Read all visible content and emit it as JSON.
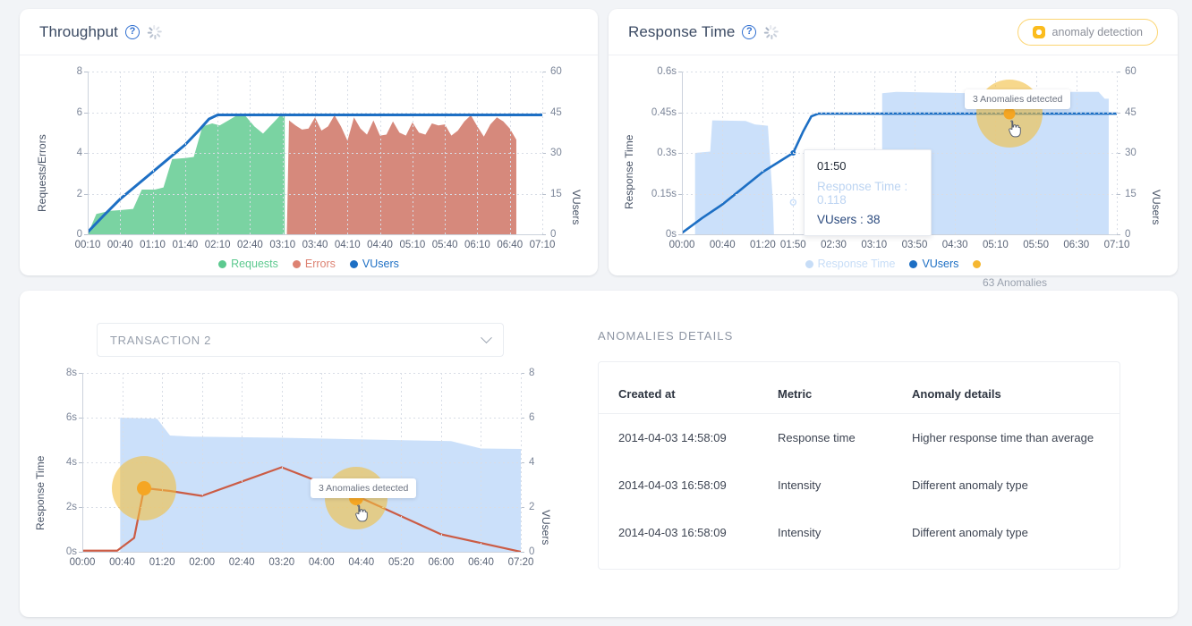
{
  "throughput": {
    "title": "Throughput",
    "help_icon": "question-circle-icon",
    "spinner_icon": "loading-spinner-icon",
    "legend": [
      {
        "label": "Requests",
        "color": "#5cc98f"
      },
      {
        "label": "Errors",
        "color": "#dd8272"
      },
      {
        "label": "VUsers",
        "color": "#1d6fc4"
      }
    ]
  },
  "response_time": {
    "title": "Response Time",
    "help_icon": "question-circle-icon",
    "spinner_icon": "loading-spinner-icon",
    "anomaly_button": {
      "label": "anomaly detection",
      "icon": "gear-icon",
      "color": "#fbbc1e"
    },
    "tooltip": {
      "time": "01:50",
      "response_time": "Response Time : 0.118",
      "vusers": "VUsers : 38"
    },
    "anomaly_marker_label": "3 Anomalies detected",
    "anomaly_count": "63 Anomalies",
    "legend": [
      {
        "label": "Response Time",
        "color": "#c7ddf7"
      },
      {
        "label": "VUsers",
        "color": "#1d6fc4"
      },
      {
        "label": "",
        "color": "#f5b731"
      }
    ]
  },
  "bottom": {
    "transaction_select": {
      "value": "TRANSACTION 2",
      "icon": "chevron-down-icon"
    },
    "anomaly_marker_label": "3 Anomalies detected",
    "section_title": "ANOMALIES DETAILS",
    "table": {
      "headers": [
        "Created at",
        "Metric",
        "Anomaly details"
      ],
      "rows": [
        [
          "2014-04-03 14:58:09",
          "Response time",
          "Higher response time than average"
        ],
        [
          "2014-04-03 16:58:09",
          "Intensity",
          "Different anomaly type"
        ],
        [
          "2014-04-03 16:58:09",
          "Intensity",
          "Different anomaly type"
        ]
      ]
    }
  },
  "chart_data": [
    {
      "type": "area",
      "id": "throughput",
      "title": "Throughput",
      "xlabel": "",
      "ylabel": "Requests/Errors",
      "y2label": "VUsers",
      "ylim": [
        0,
        8
      ],
      "y2lim": [
        0,
        60
      ],
      "yticks": [
        0,
        2,
        4,
        6,
        8
      ],
      "y2ticks": [
        0,
        15,
        30,
        45,
        60
      ],
      "xticks": [
        "00:10",
        "00:40",
        "01:10",
        "01:40",
        "02:10",
        "02:40",
        "03:10",
        "03:40",
        "04:10",
        "04:40",
        "05:10",
        "05:40",
        "06:10",
        "06:40",
        "07:10"
      ],
      "grid": true,
      "legend_position": "bottom",
      "series": [
        {
          "name": "Requests",
          "type": "area",
          "color": "#5cc98f",
          "axis": "left",
          "x": [
            "00:10",
            "00:25",
            "00:40",
            "00:55",
            "01:10",
            "01:25",
            "01:40",
            "01:55",
            "02:10",
            "02:25",
            "02:40",
            "02:55",
            "03:10"
          ],
          "values": [
            0.0,
            1.1,
            1.2,
            1.3,
            2.2,
            2.25,
            3.7,
            3.8,
            5.3,
            5.8,
            5.5,
            5.0,
            5.9
          ]
        },
        {
          "name": "Errors",
          "type": "area",
          "color": "#dd8272",
          "axis": "left",
          "x": [
            "03:15",
            "03:30",
            "03:45",
            "04:00",
            "04:15",
            "04:30",
            "04:45",
            "05:00",
            "05:15",
            "05:30",
            "05:45",
            "06:00",
            "06:15",
            "06:30",
            "06:45"
          ],
          "values": [
            5.6,
            5.2,
            5.3,
            5.8,
            4.6,
            5.7,
            4.8,
            5.6,
            4.9,
            5.4,
            5.4,
            4.8,
            5.8,
            5.7,
            4.7
          ]
        },
        {
          "name": "VUsers",
          "type": "line",
          "color": "#1d6fc4",
          "axis": "right",
          "x": [
            "00:10",
            "00:40",
            "01:10",
            "01:40",
            "02:10",
            "03:10",
            "04:10",
            "05:10",
            "06:10",
            "07:10"
          ],
          "values": [
            1,
            13,
            23,
            33,
            44,
            44,
            44,
            44,
            44,
            44
          ]
        }
      ]
    },
    {
      "type": "area",
      "id": "response_time",
      "title": "Response Time",
      "xlabel": "",
      "ylabel": "Response Time",
      "y2label": "VUsers",
      "ylim": [
        0,
        0.6
      ],
      "y2lim": [
        0,
        60
      ],
      "yticks": [
        "0s",
        "0.15s",
        "0.3s",
        "0.45s",
        "0.6s"
      ],
      "y2ticks": [
        0,
        15,
        30,
        45,
        60
      ],
      "xticks": [
        "00:00",
        "00:40",
        "01:20",
        "01:50",
        "02:30",
        "03:10",
        "03:50",
        "04:30",
        "05:10",
        "05:50",
        "06:30",
        "07:10"
      ],
      "grid": true,
      "legend_position": "bottom",
      "series": [
        {
          "name": "Response Time",
          "type": "area",
          "color": "#c7ddf7",
          "axis": "left",
          "x": [
            "00:10",
            "00:25",
            "00:40",
            "01:05",
            "01:20",
            "01:30",
            "03:20",
            "03:40",
            "05:00",
            "05:30",
            "06:30",
            "07:10"
          ],
          "values": [
            0.3,
            0.305,
            0.42,
            0.415,
            0.405,
            0.115,
            0.52,
            0.525,
            0.5,
            0.525,
            0.525,
            0.1
          ]
        },
        {
          "name": "VUsers",
          "type": "line",
          "color": "#1d6fc4",
          "axis": "right",
          "x": [
            "00:00",
            "00:40",
            "01:20",
            "01:50",
            "02:10",
            "07:10"
          ],
          "values": [
            0.5,
            11,
            23,
            30,
            44.5,
            44.5
          ]
        }
      ],
      "annotations": [
        {
          "label": "3 Anomalies detected",
          "x": "05:25",
          "y": 0.45
        },
        {
          "label": "63 Anomalies",
          "position": "below-legend"
        }
      ]
    },
    {
      "type": "line",
      "id": "transaction_2",
      "title": "TRANSACTION 2",
      "xlabel": "",
      "ylabel": "Response Time",
      "y2label": "VUsers",
      "ylim": [
        0,
        8
      ],
      "y2lim": [
        0,
        8
      ],
      "yticks": [
        "0s",
        "2s",
        "4s",
        "6s",
        "8s"
      ],
      "y2ticks": [
        0,
        2,
        4,
        6,
        8
      ],
      "xticks": [
        "00:00",
        "00:40",
        "01:20",
        "02:00",
        "02:40",
        "03:20",
        "04:00",
        "04:40",
        "05:20",
        "06:00",
        "06:40",
        "07:20"
      ],
      "grid": true,
      "legend_position": "none",
      "series": [
        {
          "name": "VUsers",
          "type": "area",
          "color": "#c7ddf7",
          "axis": "right",
          "x": [
            "00:30",
            "00:45",
            "01:00",
            "01:20",
            "01:40",
            "02:00",
            "03:20",
            "05:20",
            "06:20",
            "06:50",
            "07:20"
          ],
          "values": [
            0,
            6,
            6,
            5.9,
            5.2,
            5.1,
            5.05,
            5.0,
            4.95,
            4.6,
            4.6
          ]
        },
        {
          "name": "Response Time",
          "type": "line",
          "color": "#cf5c45",
          "axis": "left",
          "x": [
            "00:00",
            "00:30",
            "00:50",
            "01:00",
            "01:20",
            "02:00",
            "03:20",
            "04:40",
            "06:00",
            "07:20"
          ],
          "values": [
            0.05,
            0.05,
            0.6,
            2.85,
            2.75,
            2.5,
            3.8,
            2.4,
            0.8,
            0.0
          ]
        }
      ],
      "annotations": [
        {
          "label": "3 Anomalies detected",
          "x": "04:30",
          "y": 3.2
        },
        {
          "type": "anomaly-point",
          "x": "01:00",
          "y": 2.85
        },
        {
          "type": "anomaly-point",
          "x": "04:35",
          "y": 2.4
        }
      ]
    }
  ]
}
